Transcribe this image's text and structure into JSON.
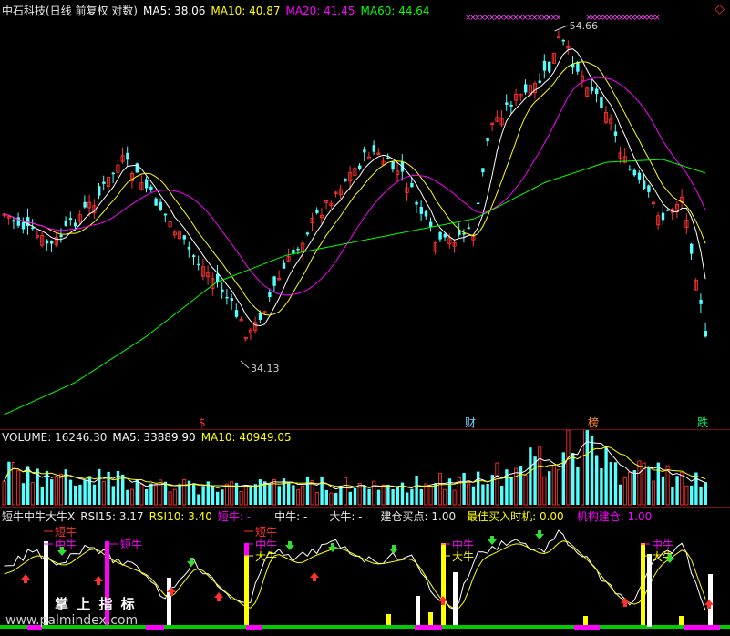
{
  "price": {
    "header": {
      "title": "中石科技(日线 前复权 对数)",
      "ma5": "MA5: 38.06",
      "ma10": "MA10: 40.87",
      "ma20": "MA20: 41.45",
      "ma60": "MA60: 44.64"
    },
    "high_label": "54.66",
    "low_label": "34.13",
    "event_markers": [
      "$",
      "财",
      "榜",
      "跌"
    ],
    "right_glyph": "◇"
  },
  "volume": {
    "header": {
      "volume": "VOLUME: 16246.30",
      "ma5": "MA5: 33889.90",
      "ma10": "MA10: 40949.05"
    }
  },
  "indicator": {
    "header": {
      "name": "短牛中牛大牛X",
      "rsi15": "RSI15: 3.17",
      "rsi10": "RSI10: 3.40",
      "short": "短牛: -",
      "mid": "中牛: -",
      "big": "大牛: -",
      "buy": "建仓买点: 1.00",
      "best": "最佳买入时机: 0.00",
      "inst": "机构建仓: 1.00"
    },
    "tags": {
      "short": "短牛",
      "mid": "中牛",
      "big": "大牛"
    },
    "watermark_text": "掌 上 指 标",
    "watermark_url": "www.palmindex.com"
  },
  "colors": {
    "up": "#ff3232",
    "down": "#54ffff",
    "ma5": "#ffffff",
    "ma10": "#ffff00",
    "ma20": "#ff00ff",
    "ma60": "#00ff00",
    "border": "#7a1010"
  },
  "chart_data": [
    {
      "type": "candlestick",
      "title": "中石科技(日线 前复权 对数)",
      "log_scale": true,
      "series_count_visible": 149,
      "annotated_high": 54.66,
      "annotated_low": 34.13,
      "ma_values_last": {
        "MA5": 38.06,
        "MA10": 40.87,
        "MA20": 41.45,
        "MA60": 44.64
      }
    },
    {
      "type": "bar",
      "title": "VOLUME",
      "last_value": 16246.3,
      "ma_values_last": {
        "MA5": 33889.9,
        "MA10": 40949.05
      }
    },
    {
      "type": "line",
      "title": "短牛中牛大牛X",
      "values_last": {
        "RSI15": 3.17,
        "RSI10": 3.4,
        "建仓买点": 1.0,
        "最佳买入时机": 0.0,
        "机构建仓": 1.0
      }
    }
  ]
}
